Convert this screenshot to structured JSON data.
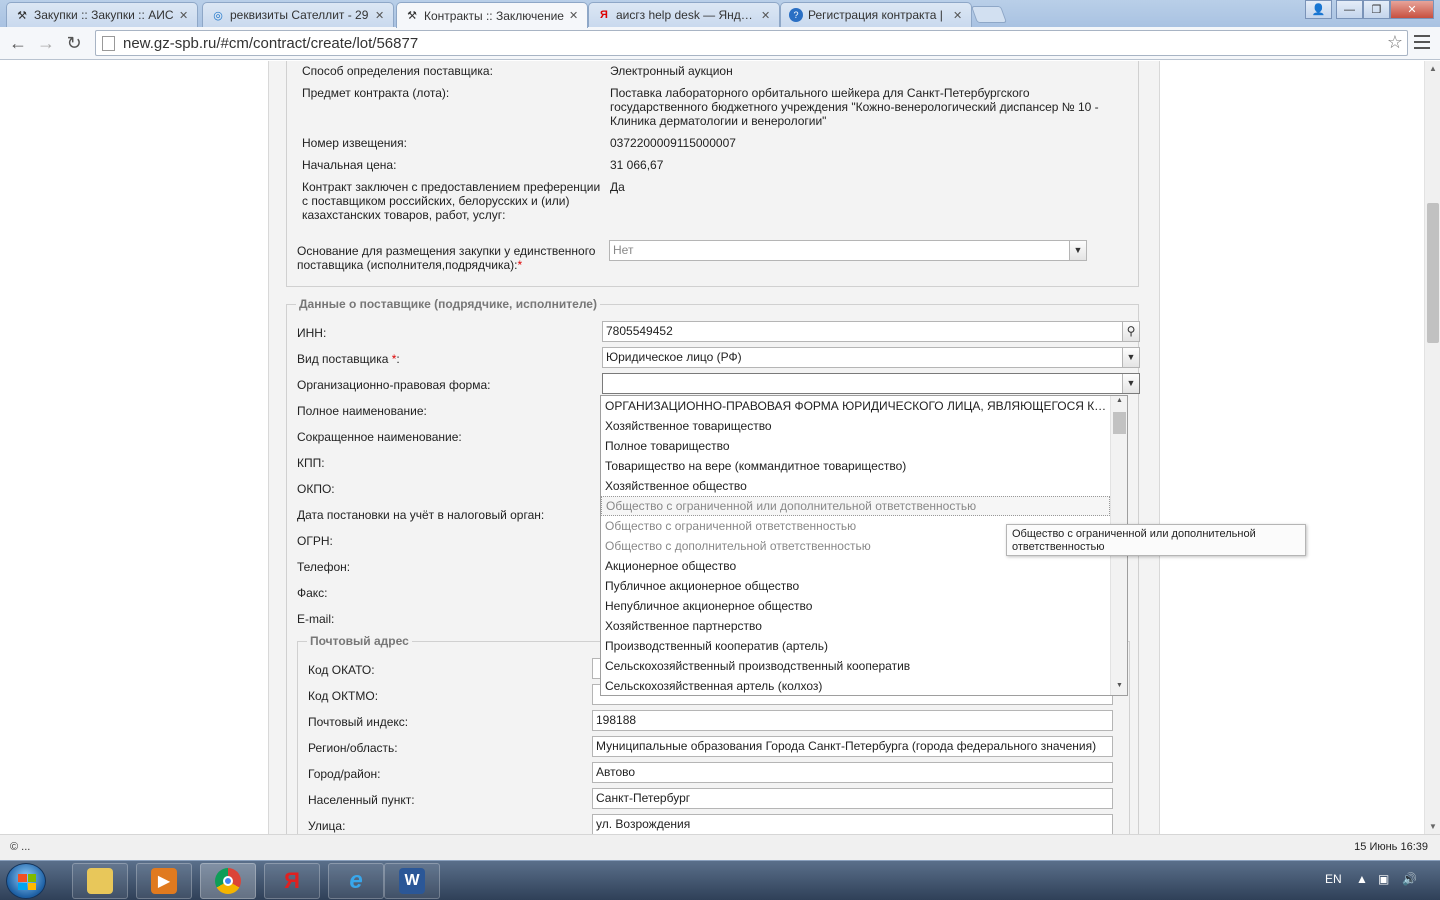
{
  "browser": {
    "tabs": [
      {
        "label": "Закупки :: Закупки :: АИС",
        "favicon": "hammer-icon",
        "active": false
      },
      {
        "label": "реквизиты Сателлит - 29",
        "favicon": "search-engine-icon",
        "active": false
      },
      {
        "label": "Контракты :: Заключение",
        "favicon": "hammer-icon",
        "active": true
      },
      {
        "label": "аисгз help desk — Яндекс",
        "favicon": "yandex-icon",
        "active": false
      },
      {
        "label": "Регистрация контракта |",
        "favicon": "help-icon",
        "active": false
      }
    ],
    "url": "new.gz-spb.ru/#cm/contract/create/lot/56877"
  },
  "lot_info": {
    "rows": [
      {
        "label": "Способ определения поставщика:",
        "value": "Электронный аукцион"
      },
      {
        "label": "Предмет контракта (лота):",
        "value": "Поставка лабораторного орбитального шейкера для Санкт-Петербургского государственного бюджетного учреждения \"Кожно-венерологический диспансер № 10 - Клиника дерматологии и венерологии\""
      },
      {
        "label": "Номер извещения:",
        "value": "0372200009115000007"
      },
      {
        "label": "Начальная цена:",
        "value": "31 066,67"
      },
      {
        "label": "Контракт заключен с предоставлением преференции с поставщиком российских, белорусских и (или) казахстанских товаров, работ, услуг:",
        "value": "Да"
      }
    ],
    "basis_label": "Основание для размещения закупки у единственного поставщика (исполнителя,подрядчика):",
    "basis_value": "Нет"
  },
  "supplier": {
    "legend": "Данные о поставщике (подрядчике, исполнителе)",
    "inn_label": "ИНН:",
    "inn_value": "7805549452",
    "type_label": "Вид поставщика",
    "type_value": "Юридическое лицо (РФ)",
    "org_form_label": "Организационно-правовая форма:",
    "org_form_value": "",
    "labels": {
      "full_name": "Полное наименование:",
      "short_name": "Сокращенное наименование:",
      "kpp": "КПП:",
      "okpo": "ОКПО:",
      "tax_date": "Дата постановки на учёт в налоговый орган:",
      "ogrn": "ОГРН:",
      "phone": "Телефон:",
      "fax": "Факс:",
      "email": "E-mail:"
    }
  },
  "postal": {
    "legend": "Почтовый адрес",
    "rows": [
      {
        "label": "Код ОКАТО:",
        "value": ""
      },
      {
        "label": "Код ОКТМО:",
        "value": ""
      },
      {
        "label": "Почтовый индекс:",
        "value": "198188"
      },
      {
        "label": "Регион/область:",
        "value": "Муниципальные образования Города Санкт-Петербурга (города федерального значения)"
      },
      {
        "label": "Город/район:",
        "value": "Автово"
      },
      {
        "label": "Населенный пункт:",
        "value": "Санкт-Петербург"
      },
      {
        "label": "Улица:",
        "value": "ул. Возрождения"
      }
    ]
  },
  "dropdown": {
    "items": [
      "ОРГАНИЗАЦИОННО-ПРАВОВАЯ ФОРМА ЮРИДИЧЕСКОГО ЛИЦА, ЯВЛЯЮЩЕГОСЯ КОММЕРЧЕСКОЙ ОРГАНИЗАЦИЕЙ",
      "Хозяйственное товарищество",
      "Полное товарищество",
      "Товарищество на вере (коммандитное товарищество)",
      "Хозяйственное общество",
      "Общество с ограниченной или дополнительной ответственностью",
      "Общество с ограниченной ответственностью",
      "Общество с дополнительной ответственностью",
      "Акционерное общество",
      "Публичное акционерное общество",
      "Непубличное акционерное общество",
      "Хозяйственное партнерство",
      "Производственный кооператив (артель)",
      "Сельскохозяйственный производственный кооператив",
      "Сельскохозяйственная артель (колхоз)"
    ],
    "hover_index": 5,
    "dim_indices": [
      5,
      6,
      7
    ],
    "tooltip": "Общество с ограниченной или дополнительной ответственностью"
  },
  "status": {
    "text": "© ...",
    "datetime": "15 Июнь 16:39"
  },
  "taskbar": {
    "lang": "EN"
  },
  "colors": {
    "required": "#dd0000",
    "panel_bg": "#f3f3f3"
  }
}
